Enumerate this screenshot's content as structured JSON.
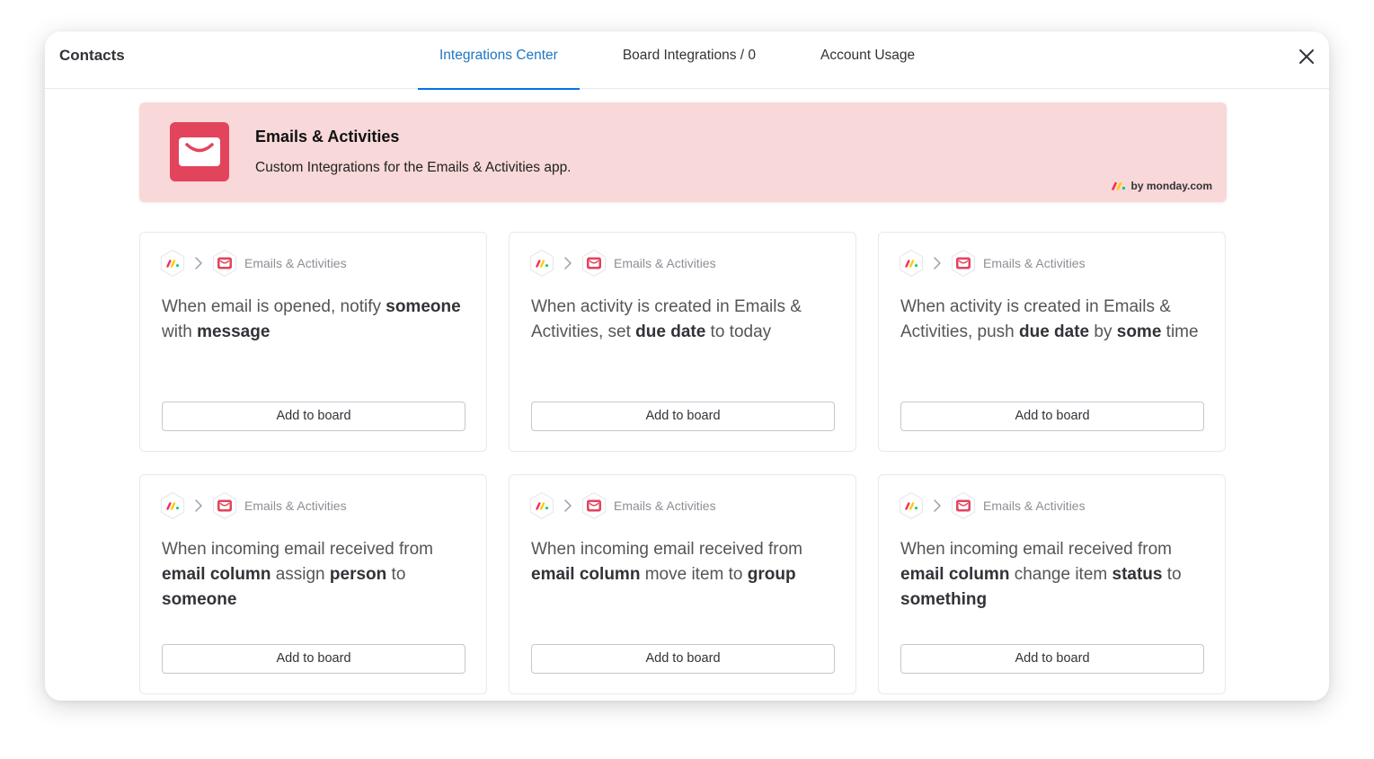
{
  "header": {
    "title": "Contacts",
    "tabs": [
      {
        "label": "Integrations Center",
        "active": true
      },
      {
        "label": "Board Integrations / 0",
        "active": false
      },
      {
        "label": "Account Usage",
        "active": false
      }
    ],
    "close_icon": "close-icon"
  },
  "banner": {
    "title": "Emails & Activities",
    "description": "Custom Integrations for the Emails & Activities app.",
    "byline": "by monday.com",
    "icon": "envelope-icon",
    "background": "#f8d8d8",
    "accent": "#e2445c"
  },
  "cards": [
    {
      "app": "Emails & Activities",
      "segments": [
        {
          "t": "When email is opened, notify ",
          "b": false
        },
        {
          "t": "someone",
          "b": true
        },
        {
          "t": " with ",
          "b": false
        },
        {
          "t": "message",
          "b": true
        }
      ],
      "button": "Add to board"
    },
    {
      "app": "Emails & Activities",
      "segments": [
        {
          "t": "When activity is created in Emails & Activities, set ",
          "b": false
        },
        {
          "t": "due date",
          "b": true
        },
        {
          "t": " to today",
          "b": false
        }
      ],
      "button": "Add to board"
    },
    {
      "app": "Emails & Activities",
      "segments": [
        {
          "t": "When activity is created in Emails & Activities, push ",
          "b": false
        },
        {
          "t": "due date",
          "b": true
        },
        {
          "t": " by ",
          "b": false
        },
        {
          "t": "some",
          "b": true
        },
        {
          "t": " time",
          "b": false
        }
      ],
      "button": "Add to board"
    },
    {
      "app": "Emails & Activities",
      "segments": [
        {
          "t": "When incoming email received from ",
          "b": false
        },
        {
          "t": "email column",
          "b": true
        },
        {
          "t": " assign ",
          "b": false
        },
        {
          "t": "person",
          "b": true
        },
        {
          "t": " to ",
          "b": false
        },
        {
          "t": "someone",
          "b": true
        }
      ],
      "button": "Add to board"
    },
    {
      "app": "Emails & Activities",
      "segments": [
        {
          "t": "When incoming email received from ",
          "b": false
        },
        {
          "t": "email column",
          "b": true
        },
        {
          "t": " move item to ",
          "b": false
        },
        {
          "t": "group",
          "b": true
        }
      ],
      "button": "Add to board"
    },
    {
      "app": "Emails & Activities",
      "segments": [
        {
          "t": "When incoming email received from ",
          "b": false
        },
        {
          "t": "email column",
          "b": true
        },
        {
          "t": " change item ",
          "b": false
        },
        {
          "t": "status",
          "b": true
        },
        {
          "t": " to ",
          "b": false
        },
        {
          "t": "something",
          "b": true
        }
      ],
      "button": "Add to board"
    }
  ],
  "icons": {
    "source": "monday-logo-icon",
    "arrow": "chevron-right-icon",
    "target": "envelope-icon"
  }
}
